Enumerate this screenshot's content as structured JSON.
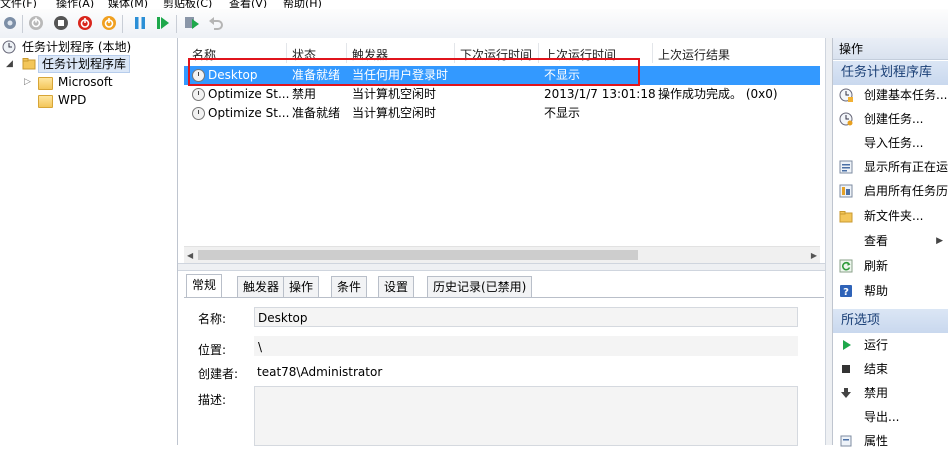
{
  "menu": {
    "items": [
      "文件(F)",
      "操作(A)",
      "媒体(M)",
      "剪贴板(C)",
      "查看(V)",
      "帮助(H)"
    ]
  },
  "tree": {
    "root": "任务计划程序 (本地)",
    "library": "任务计划程序库",
    "children": [
      "Microsoft",
      "WPD"
    ]
  },
  "task_list": {
    "columns": [
      "名称",
      "状态",
      "触发器",
      "下次运行时间",
      "上次运行时间",
      "上次运行结果"
    ],
    "rows": [
      {
        "name": "Desktop",
        "status": "准备就绪",
        "trigger": "当任何用户登录时",
        "next_run": "",
        "last_run": "不显示",
        "last_result": ""
      },
      {
        "name": "Optimize St...",
        "status": "禁用",
        "trigger": "当计算机空闲时",
        "next_run": "",
        "last_run": "2013/1/7 13:01:18",
        "last_result": "操作成功完成。 (0x0)"
      },
      {
        "name": "Optimize St...",
        "status": "准备就绪",
        "trigger": "当计算机空闲时",
        "next_run": "",
        "last_run": "不显示",
        "last_result": ""
      }
    ]
  },
  "detail": {
    "tabs": [
      "常规",
      "触发器",
      "操作",
      "条件",
      "设置",
      "历史记录(已禁用)"
    ],
    "active_tab": "常规",
    "fields": {
      "name_label": "名称:",
      "name_value": "Desktop",
      "location_label": "位置:",
      "location_value": "\\",
      "author_label": "创建者:",
      "author_value": "teat78\\Administrator",
      "description_label": "描述:",
      "description_value": ""
    }
  },
  "actions": {
    "header": "操作",
    "section_library": "任务计划程序库",
    "library_items": [
      {
        "label": "创建基本任务...",
        "icon": "create-basic-task-icon"
      },
      {
        "label": "创建任务...",
        "icon": "create-task-icon"
      },
      {
        "label": "导入任务...",
        "icon": ""
      },
      {
        "label": "显示所有正在运",
        "icon": "running-tasks-icon"
      },
      {
        "label": "启用所有任务历",
        "icon": "enable-history-icon"
      },
      {
        "label": "新文件夹...",
        "icon": "new-folder-icon"
      },
      {
        "label": "查看",
        "icon": ""
      },
      {
        "label": "刷新",
        "icon": "refresh-icon"
      },
      {
        "label": "帮助",
        "icon": "help-icon"
      }
    ],
    "section_selected": "所选项",
    "selected_items": [
      {
        "label": "运行",
        "icon": "run-icon"
      },
      {
        "label": "结束",
        "icon": "end-icon"
      },
      {
        "label": "禁用",
        "icon": "disable-icon"
      },
      {
        "label": "导出...",
        "icon": ""
      },
      {
        "label": "属性",
        "icon": "properties-icon"
      }
    ]
  },
  "colors": {
    "selection": "#3399ff",
    "highlight_box": "#e0141c",
    "section_text": "#1a3f76"
  }
}
